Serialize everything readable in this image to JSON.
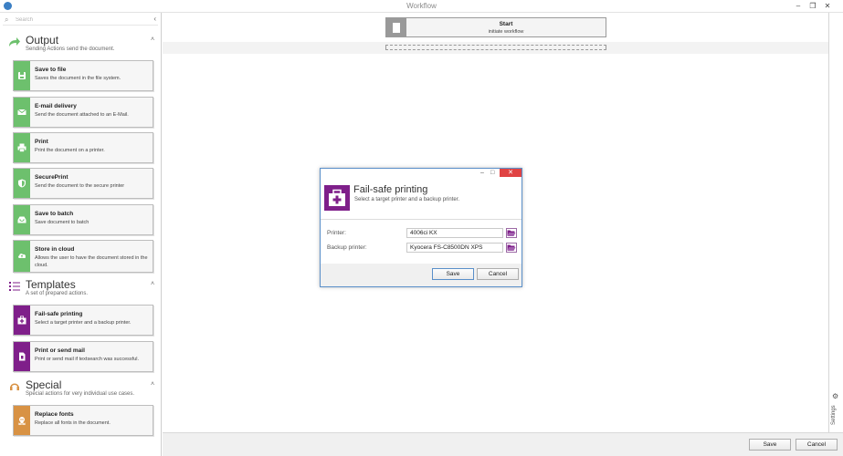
{
  "window": {
    "title": "Workflow",
    "controls": [
      "–",
      "❐",
      "✕"
    ]
  },
  "sidebar": {
    "search_placeholder": "Search",
    "collapse_glyph": "‹",
    "sections": [
      {
        "title": "Output",
        "subtitle": "Sending Actions send the document.",
        "items": [
          {
            "title": "Save to file",
            "desc": "Saves the document in the file system.",
            "icon": "save-icon"
          },
          {
            "title": "E-mail delivery",
            "desc": "Send the document attached to an E-Mail.",
            "icon": "mail-icon"
          },
          {
            "title": "Print",
            "desc": "Print the document on a printer.",
            "icon": "printer-icon"
          },
          {
            "title": "SecurePrint",
            "desc": "Send the document to the secure printer",
            "icon": "shield-icon"
          },
          {
            "title": "Save to batch",
            "desc": "Save document to batch",
            "icon": "tray-icon"
          },
          {
            "title": "Store in cloud",
            "desc": "Allows the user to have the document stored in the cloud.",
            "icon": "cloud-upload-icon"
          }
        ]
      },
      {
        "title": "Templates",
        "subtitle": "A set of prepared actions.",
        "items": [
          {
            "title": "Fail-safe printing",
            "desc": "Select a target printer and a backup printer.",
            "icon": "first-aid-kit-icon"
          },
          {
            "title": "Print or send mail",
            "desc": "Print or send mail if textsearch was successful.",
            "icon": "document-icon"
          }
        ]
      },
      {
        "title": "Special",
        "subtitle": "Special actions for very individual use cases.",
        "items": [
          {
            "title": "Replace fonts",
            "desc": "Replace all fonts in the document.",
            "icon": "skull-icon"
          }
        ]
      }
    ]
  },
  "workflow": {
    "start_title": "Start",
    "start_subtitle": "initiate workflow"
  },
  "rightbar": {
    "settings_label": "Settings"
  },
  "dialog": {
    "title": "Fail-safe printing",
    "subtitle": "Select a target printer and a backup printer.",
    "printer_label": "Printer:",
    "printer_value": "4006ci KX",
    "backup_label": "Backup printer:",
    "backup_value": "Kyocera FS-C8500DN XPS",
    "save_label": "Save",
    "cancel_label": "Cancel"
  },
  "footer": {
    "save_label": "Save",
    "cancel_label": "Cancel"
  },
  "colors": {
    "output_accent": "#6dc06d",
    "templates_accent": "#7f1f8a",
    "special_accent": "#d89244",
    "close_red": "#e04343"
  }
}
